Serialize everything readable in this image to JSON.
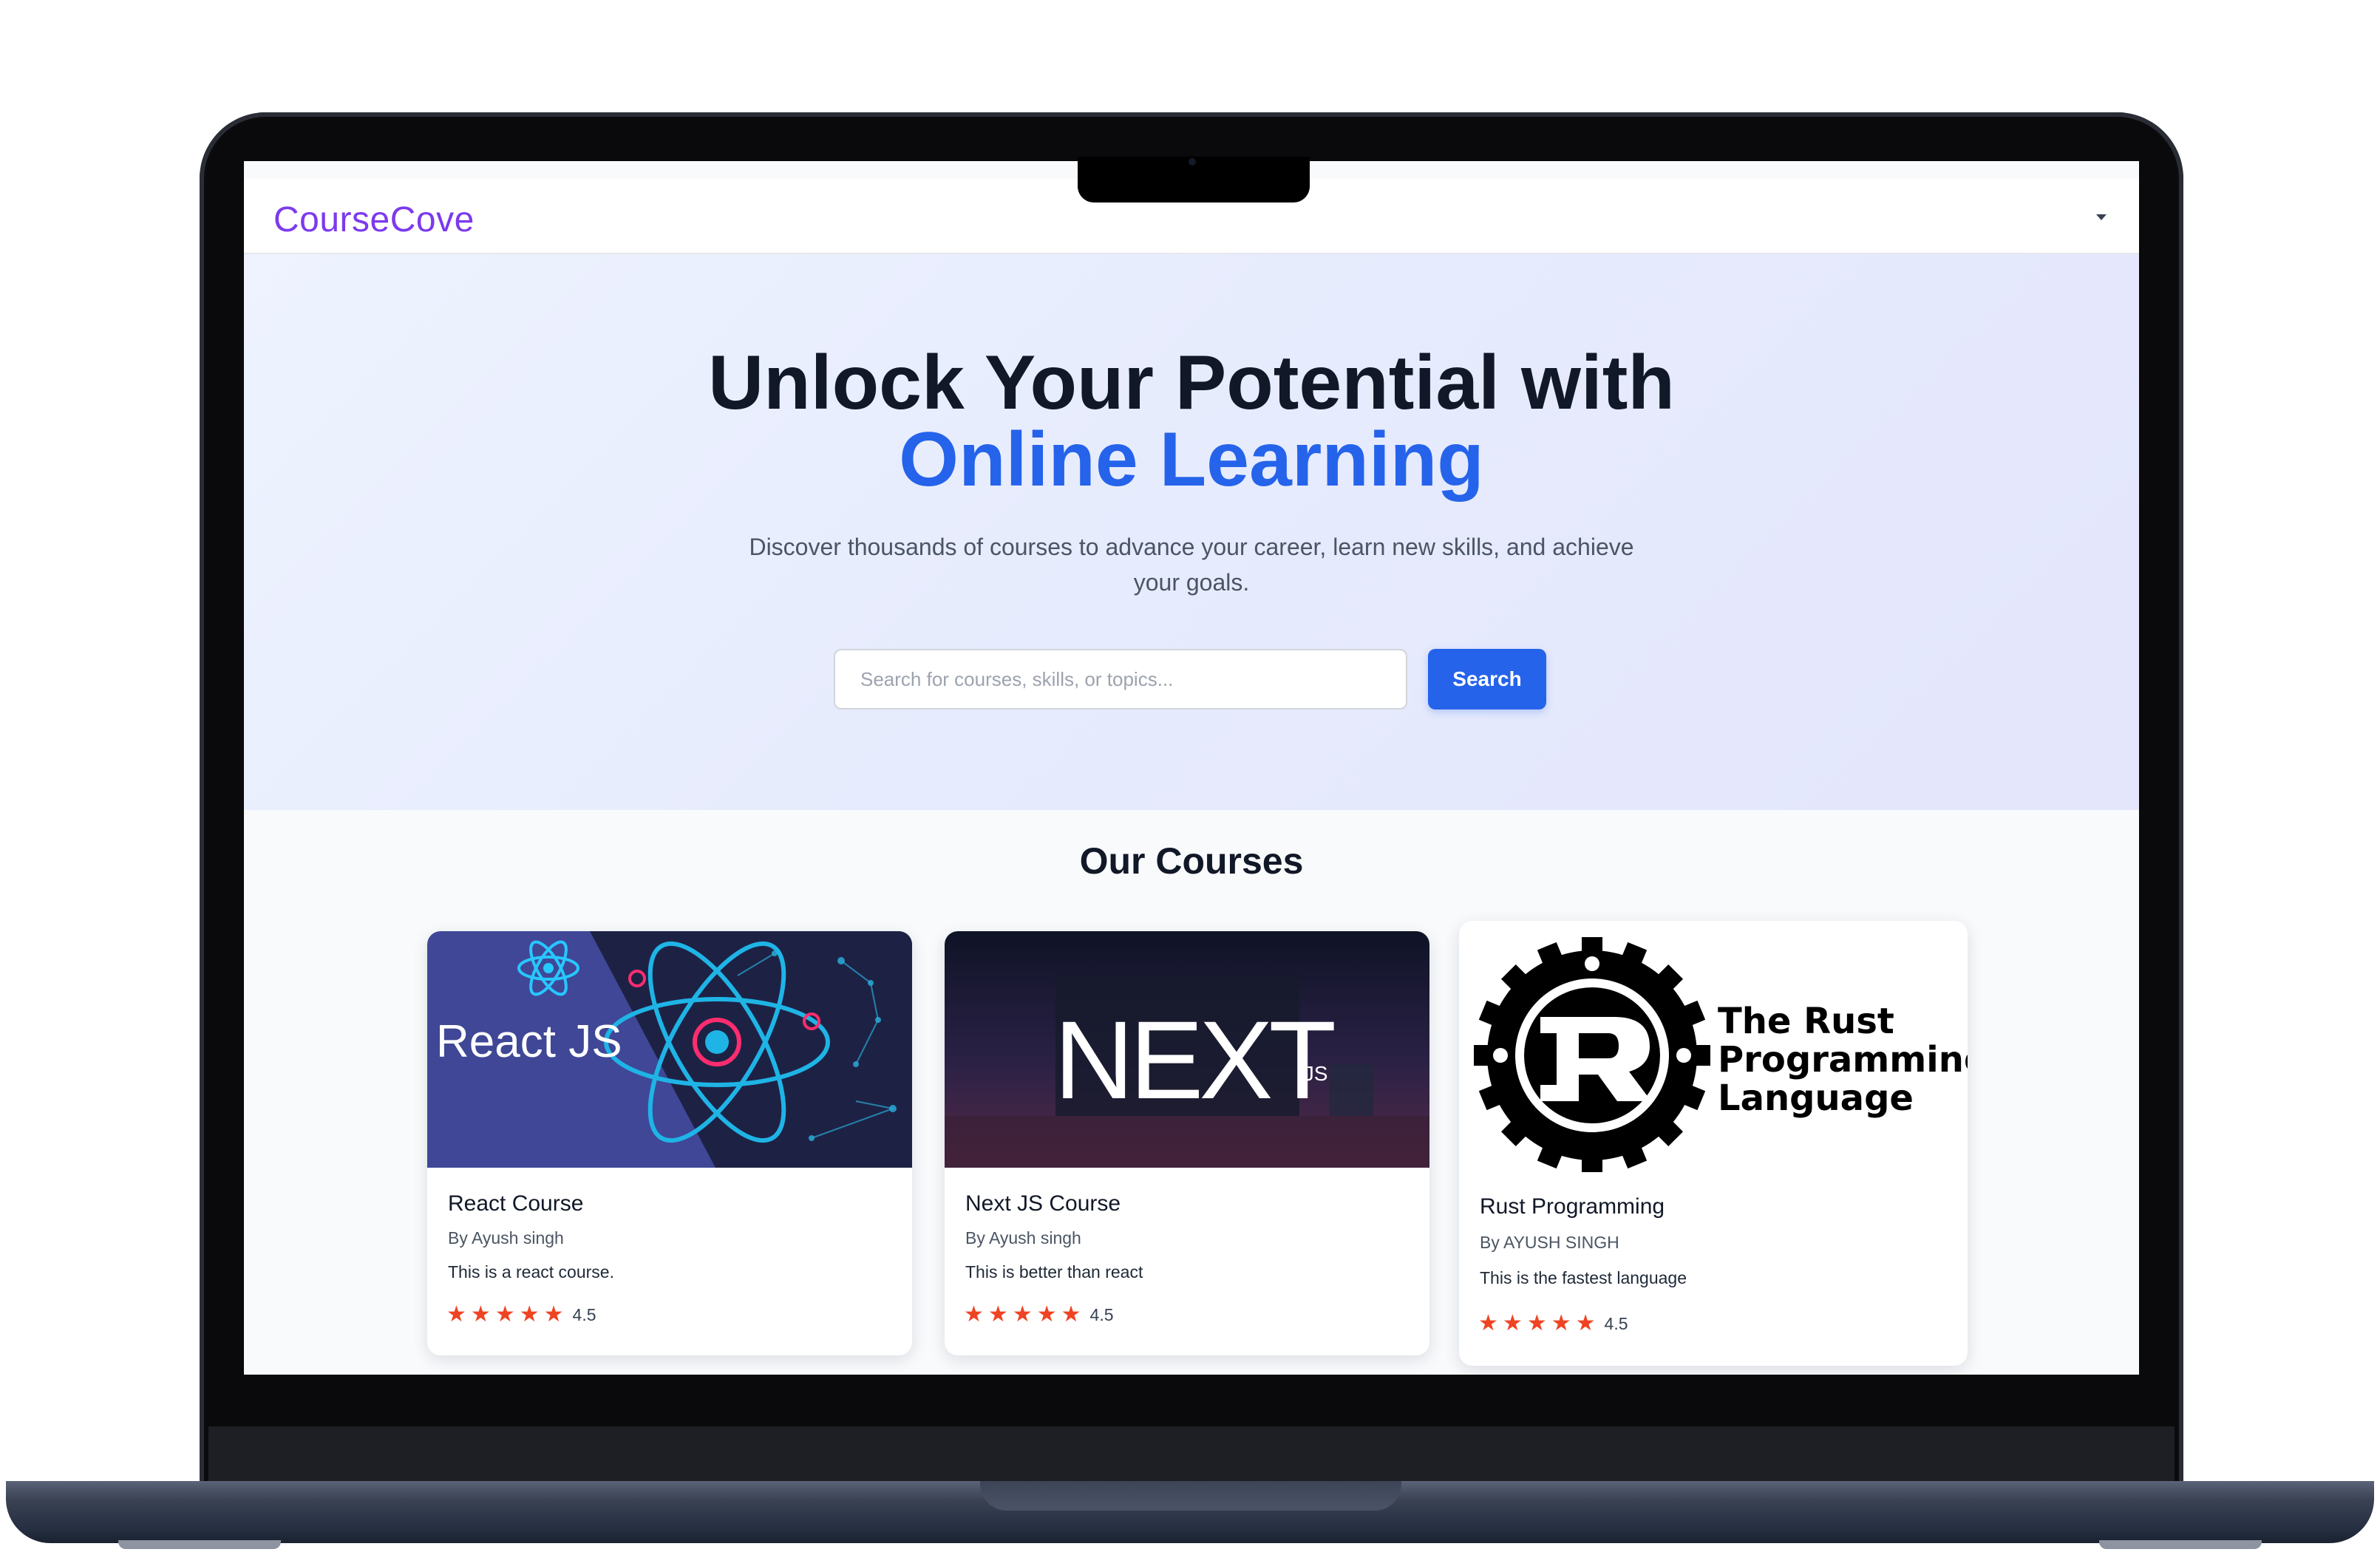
{
  "navbar": {
    "brand": "CourseCove"
  },
  "hero": {
    "title_line1": "Unlock Your Potential with",
    "title_line2": "Online Learning",
    "subtitle": "Discover thousands of courses to advance your career, learn new skills, and achieve your goals.",
    "search_placeholder": "Search for courses, skills, or topics...",
    "search_button": "Search"
  },
  "courses": {
    "heading": "Our Courses",
    "items": [
      {
        "title": "React Course",
        "author": "By Ayush singh",
        "description": "This is a react course.",
        "rating": "4.5",
        "stars": 5,
        "thumbnail_text": "React JS"
      },
      {
        "title": "Next JS Course",
        "author": "By Ayush singh",
        "description": "This is better than react",
        "rating": "4.5",
        "stars": 5,
        "thumbnail_text": "NEXT",
        "thumbnail_suffix": ".JS"
      },
      {
        "title": "Rust Programming",
        "author": "By AYUSH SINGH",
        "description": "This is the fastest language",
        "rating": "4.5",
        "stars": 5,
        "thumbnail_lines": [
          "The Rust",
          "Programming",
          "Language"
        ]
      }
    ]
  },
  "colors": {
    "brand": "#7c3aed",
    "accent": "#2563eb",
    "star": "#ef4423"
  },
  "icons": {
    "menu": "caret-down-icon",
    "star": "star-icon"
  }
}
